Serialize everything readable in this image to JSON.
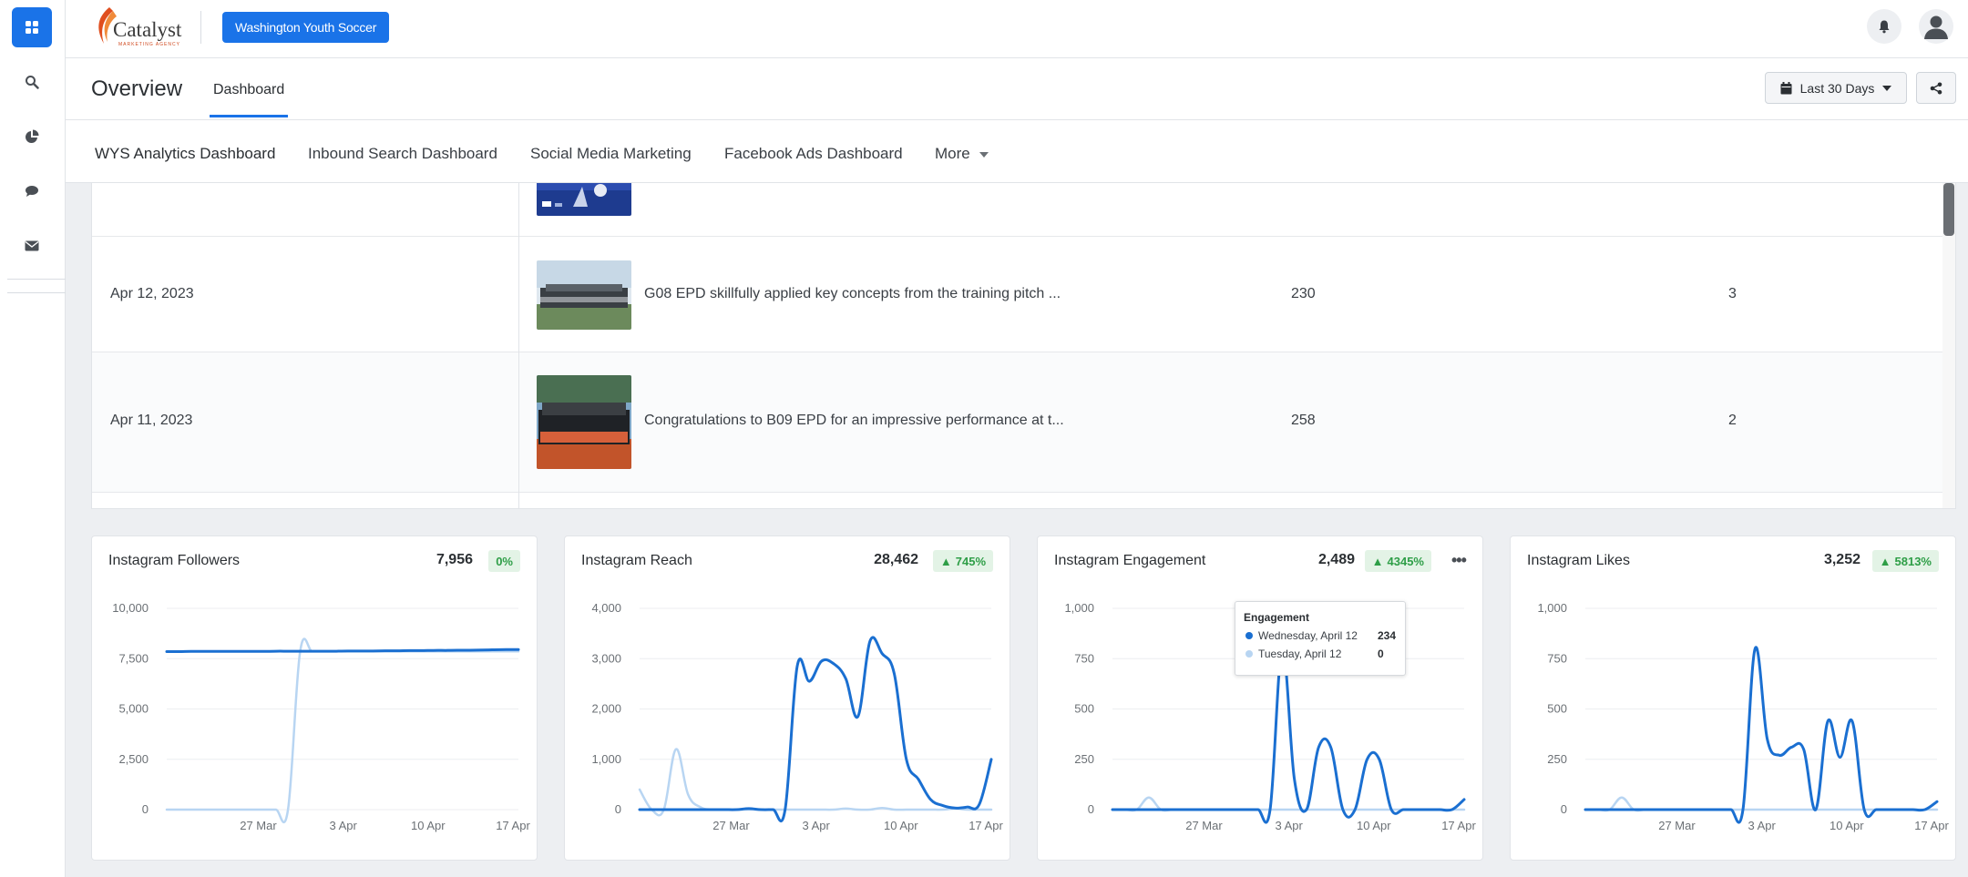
{
  "brand": {
    "name": "Catalyst",
    "tagline": "MARKETING AGENCY"
  },
  "client_button": "Washington Youth Soccer",
  "header": {
    "title": "Overview",
    "tab": "Dashboard",
    "date_range": "Last 30 Days"
  },
  "tabs": [
    "WYS Analytics Dashboard",
    "Inbound Search Dashboard",
    "Social Media Marketing",
    "Facebook Ads Dashboard",
    "More"
  ],
  "posts": [
    {
      "date": "Apr 12, 2023",
      "caption": "G08 EPD skillfully applied key concepts from the training pitch ...",
      "value_a": "230",
      "value_b": "3"
    },
    {
      "date": "Apr 11, 2023",
      "caption": "Congratulations to B09 EPD for an impressive performance at t...",
      "value_a": "258",
      "value_b": "2"
    }
  ],
  "colors": {
    "accent": "#1a73e8",
    "series_current": "#1a6fd1",
    "series_previous": "#b8d5f2",
    "positive": "#2e9e47"
  },
  "cards": [
    {
      "title": "Instagram Followers",
      "total": "7,956",
      "change": "0%",
      "has_arrow": false
    },
    {
      "title": "Instagram Reach",
      "total": "28,462",
      "change": "745%",
      "has_arrow": true
    },
    {
      "title": "Instagram Engagement",
      "total": "2,489",
      "change": "4345%",
      "has_arrow": true
    },
    {
      "title": "Instagram Likes",
      "total": "3,252",
      "change": "5813%",
      "has_arrow": true
    }
  ],
  "tooltip": {
    "title": "Engagement",
    "rows": [
      {
        "label": "Wednesday, April 12",
        "value": "234"
      },
      {
        "label": "Tuesday, April 12",
        "value": "0"
      }
    ]
  },
  "chart_data": [
    {
      "type": "line",
      "title": "Instagram Followers",
      "x_ticks": [
        "27 Mar",
        "3 Apr",
        "10 Apr",
        "17 Apr"
      ],
      "y_ticks": [
        "0",
        "2,500",
        "5,000",
        "7,500",
        "10,000"
      ],
      "ylim": [
        0,
        10000
      ],
      "x": [
        0,
        1,
        2,
        3,
        4,
        5,
        6,
        7,
        8,
        9,
        10,
        11,
        12,
        13,
        14,
        15,
        16,
        17,
        18,
        19,
        20,
        21,
        22,
        23,
        24,
        25,
        26,
        27,
        28,
        29
      ],
      "series": [
        {
          "values": [
            7850,
            7850,
            7860,
            7860,
            7860,
            7860,
            7860,
            7860,
            7860,
            7870,
            7870,
            7870,
            7870,
            7870,
            7870,
            7880,
            7880,
            7880,
            7890,
            7890,
            7900,
            7900,
            7910,
            7910,
            7920,
            7920,
            7930,
            7940,
            7950,
            7956
          ]
        },
        {
          "values": [
            0,
            0,
            0,
            0,
            0,
            0,
            0,
            0,
            0,
            0,
            0,
            7850,
            7860,
            7860,
            7860,
            7860,
            7860,
            7860,
            7860,
            7860,
            7860,
            7860,
            7860,
            7860,
            7860,
            7860,
            7860,
            7860,
            7860,
            7860
          ]
        }
      ]
    },
    {
      "type": "line",
      "title": "Instagram Reach",
      "x_ticks": [
        "27 Mar",
        "3 Apr",
        "10 Apr",
        "17 Apr"
      ],
      "y_ticks": [
        "0",
        "1,000",
        "2,000",
        "3,000",
        "4,000"
      ],
      "ylim": [
        0,
        4000
      ],
      "x": [
        0,
        1,
        2,
        3,
        4,
        5,
        6,
        7,
        8,
        9,
        10,
        11,
        12,
        13,
        14,
        15,
        16,
        17,
        18,
        19,
        20,
        21,
        22,
        23,
        24,
        25,
        26,
        27,
        28,
        29
      ],
      "series": [
        {
          "values": [
            0,
            0,
            0,
            0,
            0,
            0,
            0,
            0,
            0,
            20,
            0,
            0,
            0,
            2850,
            2550,
            2950,
            2900,
            2600,
            1850,
            3350,
            3100,
            2700,
            1000,
            600,
            200,
            80,
            30,
            50,
            100,
            1000
          ]
        },
        {
          "values": [
            400,
            0,
            0,
            1200,
            300,
            50,
            0,
            0,
            0,
            0,
            0,
            0,
            0,
            0,
            0,
            0,
            0,
            20,
            0,
            0,
            30,
            0,
            0,
            0,
            0,
            0,
            20,
            0,
            0,
            0
          ]
        }
      ]
    },
    {
      "type": "line",
      "title": "Instagram Engagement",
      "x_ticks": [
        "27 Mar",
        "3 Apr",
        "10 Apr",
        "17 Apr"
      ],
      "y_ticks": [
        "0",
        "250",
        "500",
        "750",
        "1,000"
      ],
      "ylim": [
        0,
        1000
      ],
      "x": [
        0,
        1,
        2,
        3,
        4,
        5,
        6,
        7,
        8,
        9,
        10,
        11,
        12,
        13,
        14,
        15,
        16,
        17,
        18,
        19,
        20,
        21,
        22,
        23,
        24,
        25,
        26,
        27,
        28,
        29
      ],
      "series": [
        {
          "values": [
            0,
            0,
            0,
            0,
            0,
            0,
            0,
            0,
            0,
            0,
            0,
            0,
            0,
            0,
            800,
            150,
            0,
            310,
            310,
            0,
            0,
            250,
            250,
            0,
            0,
            0,
            0,
            0,
            0,
            50
          ]
        },
        {
          "values": [
            0,
            0,
            0,
            60,
            0,
            0,
            0,
            0,
            0,
            0,
            0,
            0,
            0,
            0,
            0,
            0,
            0,
            0,
            0,
            0,
            0,
            0,
            0,
            0,
            0,
            0,
            0,
            0,
            0,
            0
          ]
        }
      ]
    },
    {
      "type": "line",
      "title": "Instagram Likes",
      "x_ticks": [
        "27 Mar",
        "3 Apr",
        "10 Apr",
        "17 Apr"
      ],
      "y_ticks": [
        "0",
        "250",
        "500",
        "750",
        "1,000"
      ],
      "ylim": [
        0,
        1000
      ],
      "x": [
        0,
        1,
        2,
        3,
        4,
        5,
        6,
        7,
        8,
        9,
        10,
        11,
        12,
        13,
        14,
        15,
        16,
        17,
        18,
        19,
        20,
        21,
        22,
        23,
        24,
        25,
        26,
        27,
        28,
        29
      ],
      "series": [
        {
          "values": [
            0,
            0,
            0,
            0,
            0,
            0,
            0,
            0,
            0,
            0,
            0,
            0,
            0,
            0,
            800,
            350,
            270,
            310,
            300,
            0,
            440,
            260,
            440,
            0,
            0,
            0,
            0,
            0,
            0,
            40
          ]
        },
        {
          "values": [
            0,
            0,
            0,
            60,
            0,
            0,
            0,
            0,
            0,
            0,
            0,
            0,
            0,
            0,
            0,
            0,
            0,
            0,
            0,
            0,
            0,
            0,
            0,
            0,
            0,
            0,
            0,
            0,
            0,
            0
          ]
        }
      ]
    }
  ]
}
